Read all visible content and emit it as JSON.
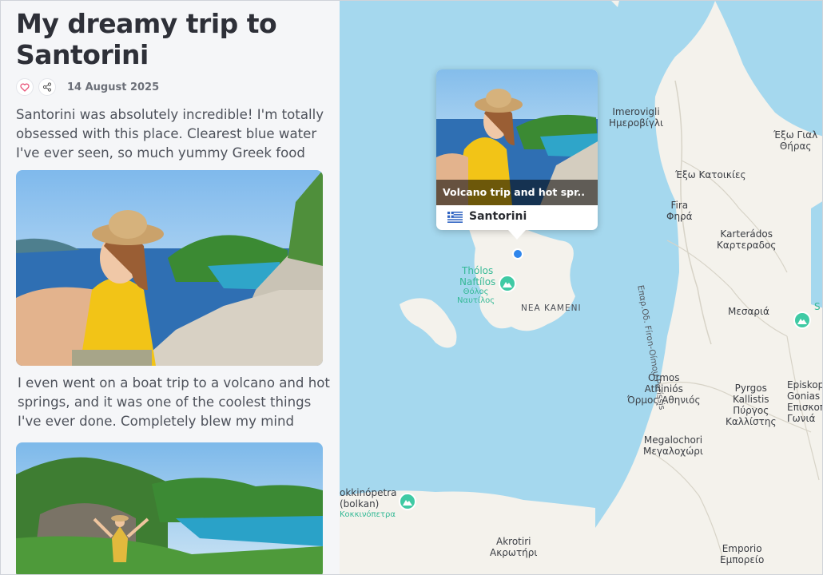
{
  "article": {
    "title": "My dreamy trip to Santorini",
    "date": "14 August 2025",
    "paragraph1": "Santorini was absolutely incredible! I'm totally obsessed with this place. Clearest blue water I've ever seen, so much yummy Greek food",
    "paragraph2": "I even went on a boat trip to a volcano and hot springs, and it was one of the coolest things I've ever done. Completely blew my mind",
    "like_icon": "heart-icon",
    "share_icon": "share-icon",
    "photos": [
      "selfie-photo",
      "cove-photo"
    ]
  },
  "popup": {
    "caption": "Volcano trip and hot spr..",
    "place": "Santorini",
    "flag": "greece-flag"
  },
  "map_labels": {
    "imerovigli": "Imerovigli",
    "imerovigli_gr": "Ημεροβίγλι",
    "exo_gialos": "Έξω Γιαλ",
    "thiras": "Θήρας",
    "exo_katoikies": "Έξω Κατοικίες",
    "fira": "Fira",
    "fira_gr": "Φηρά",
    "karterados": "Karterádos",
    "karterados_gr": "Καρτεραδος",
    "road": "Επαρ.Οδ. Fíron-Oímou Períssis",
    "tholos": "Thólos",
    "naftilos": "Naftílos",
    "tholos_gr": "Θόλος",
    "naftilos_gr": "Ναυτίλος",
    "nea_kameni": "NEA KAMENI",
    "mesaria": "Μεσαριά",
    "ormos": "Órmos",
    "athinios": "Athiniós",
    "ormos_gr": "Όρμος Αθηνιός",
    "pyrgos": "Pyrgos",
    "kallistis": "Kallistis",
    "pyrgos_gr": "Πύργος",
    "kallistis_gr": "Καλλίστης",
    "episkopi": "Episkop",
    "gonias": "Gonias",
    "episkopi_gr": "Επισκοπ",
    "gonias_gr": "Γωνιά",
    "s_partial": "S",
    "megalochori": "Megalochori",
    "megalochori_gr": "Μεγαλοχώρι",
    "kokkinopetra": "okkinópetra",
    "bolkan": "(bolkan)",
    "kokkinopetra_gr": "Κοκκινόπετρα",
    "akrotiri": "Akrotiri",
    "akrotiri_gr": "Ακρωτήρι",
    "emporio": "Emporio",
    "emporio_gr": "Εμπορείο"
  },
  "colors": {
    "sea": "#a5d8ee",
    "land": "#f4f2ec",
    "poi": "#3fcaa4",
    "location": "#2f86ec",
    "heart": "#e8557a"
  }
}
